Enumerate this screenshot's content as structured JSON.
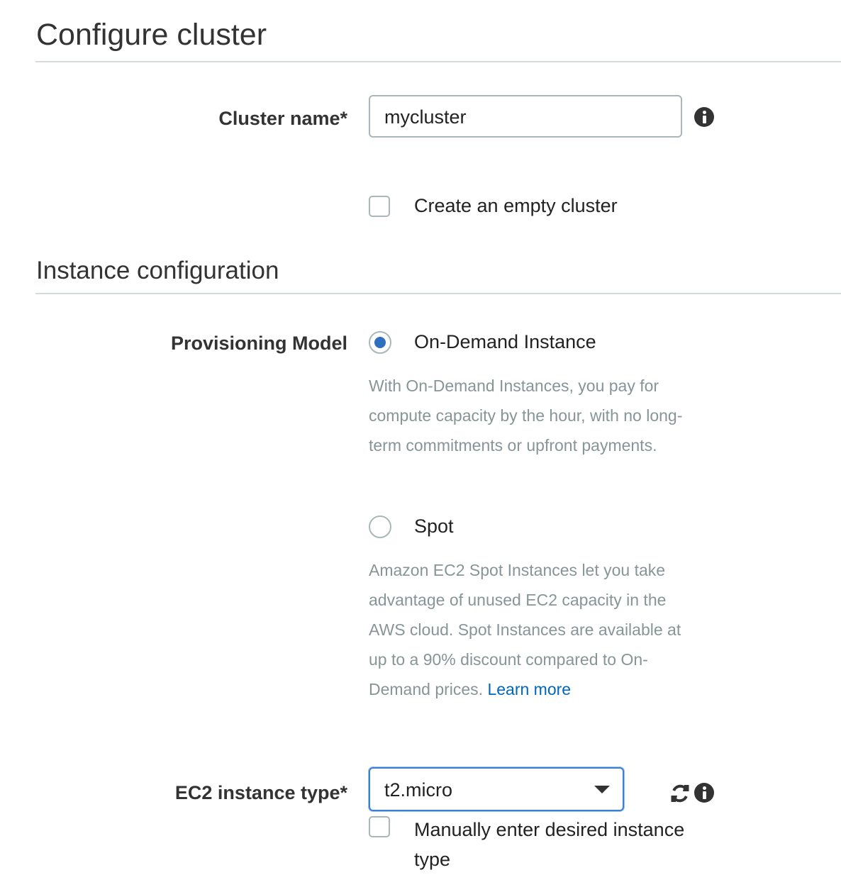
{
  "header": {
    "title": "Configure cluster"
  },
  "cluster": {
    "name_label": "Cluster name*",
    "name_value": "mycluster",
    "empty_cluster_label": "Create an empty cluster"
  },
  "instance_config": {
    "title": "Instance configuration",
    "provisioning_label": "Provisioning Model",
    "options": [
      {
        "label": "On-Demand Instance",
        "selected": true,
        "description": "With On-Demand Instances, you pay for compute capacity by the hour, with no long-term commitments or upfront payments."
      },
      {
        "label": "Spot",
        "selected": false,
        "description": "Amazon EC2 Spot Instances let you take advantage of unused EC2 capacity in the AWS cloud. Spot Instances are available at up to a 90% discount compared to On-Demand prices.",
        "link_text": "Learn more"
      }
    ],
    "instance_type_label": "EC2 instance type*",
    "instance_type_value": "t2.micro",
    "manual_entry_label": "Manually enter desired instance type"
  },
  "icons": {
    "info": "info-icon",
    "refresh": "refresh-icon",
    "dropdown": "chevron-down-icon"
  },
  "colors": {
    "accent": "#2e6fbf",
    "link": "#0066c0",
    "focus_border": "#3b7fd4",
    "muted_text": "#879596"
  }
}
